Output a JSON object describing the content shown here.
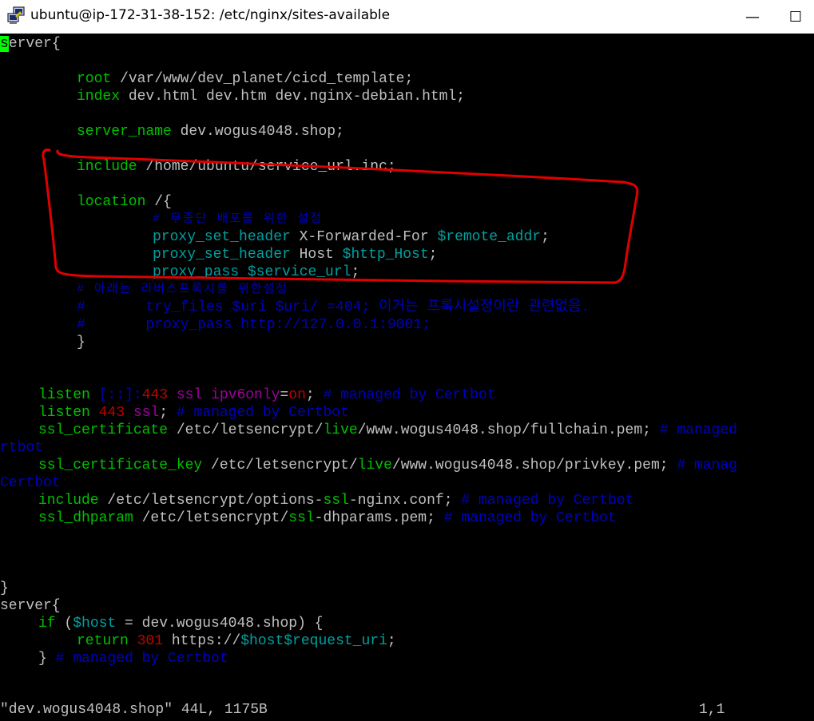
{
  "window": {
    "title": "ubuntu@ip-172-31-38-152: /etc/nginx/sites-available",
    "minimize_glyph": "—",
    "maximize_glyph": "☐",
    "close_glyph": "✕",
    "icon": "putty-icon"
  },
  "editor": {
    "cursor_char": "s",
    "lines": {
      "l1": "erver{",
      "l3a": "root",
      "l3b": " /var/www/dev_planet/cicd_template;",
      "l4a": "index",
      "l4b": " dev.html dev.htm dev.nginx-debian.html;",
      "l6a": "server_name",
      "l6b": " dev.wogus4048.shop;",
      "l8a": "include",
      "l8b": " /home/ubuntu/service_url.inc;",
      "l10a": "location",
      "l10b": " /{",
      "l11": "# 무중단 배포를 위한 설정",
      "l12a": "proxy_set_header",
      "l12b": " X-Forwarded-For ",
      "l12c": "$remote_addr",
      "l12d": ";",
      "l13a": "proxy_set_header",
      "l13b": " Host ",
      "l13c": "$http_Host",
      "l13d": ";",
      "l14a": "proxy_pass",
      "l14b": " ",
      "l14c": "$service_url",
      "l14d": ";",
      "l15": "# 아래는 리버스프록시를 위한설정",
      "l16": "#       try_files $uri $uri/ =404; 이거는 프록시설정이란 관련없음.",
      "l17": "#       proxy_pass http://127.0.0.1:9001;",
      "l18": "}",
      "l21a": "listen",
      "l21b": " [::]:",
      "l21c": "443",
      "l21d": " ssl ipv6only",
      "l21e": "=",
      "l21f": "on",
      "l21g": "; ",
      "l21h": "# managed by Certbot",
      "l22a": "listen",
      "l22b": " ",
      "l22c": "443",
      "l22d": " ssl",
      "l22e": "; ",
      "l22f": "# managed by Certbot",
      "l23a": "ssl_certificate",
      "l23b": " /etc/letsencrypt/",
      "l23c": "live",
      "l23d": "/www.wogus4048.shop/fullchain.pem; ",
      "l23e": "# managed",
      "l23w": "rtbot",
      "l24a": "ssl_certificate_key",
      "l24b": " /etc/letsencrypt/",
      "l24c": "live",
      "l24d": "/www.wogus4048.shop/privkey.pem; ",
      "l24e": "# manag",
      "l24w": "Certbot",
      "l25a": "include",
      "l25b": " /etc/letsencrypt/options-",
      "l25c": "ssl",
      "l25d": "-nginx.conf; ",
      "l25e": "# managed by Certbot",
      "l26a": "ssl_dhparam",
      "l26b": " /etc/letsencrypt/",
      "l26c": "ssl",
      "l26d": "-dhparams.pem; ",
      "l26e": "# managed by Certbot",
      "l30": "}",
      "l31": "server{",
      "l32a": "if",
      "l32b": " (",
      "l32c": "$host",
      "l32d": " = dev.wogus4048.shop) {",
      "l33a": "return",
      "l33b": " ",
      "l33c": "301",
      "l33d": " https://",
      "l33e": "$host$request_uri",
      "l33f": ";",
      "l34a": "} ",
      "l34b": "# managed by Certbot"
    }
  },
  "statusbar": {
    "file_info": "\"dev.wogus4048.shop\" 44L, 1175B",
    "position": "1,1"
  },
  "colors": {
    "keyword": "#00c000",
    "comment": "#0000c0",
    "variable": "#00a0a0",
    "number": "#c00000",
    "annotation": "#e00000",
    "cursor": "#00ff00"
  }
}
